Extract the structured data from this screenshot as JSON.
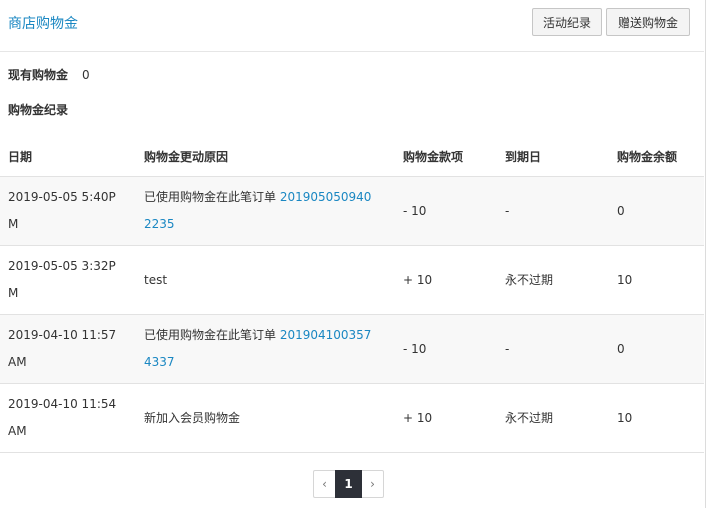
{
  "header": {
    "title": "商店购物金",
    "activity_button": "活动纪录",
    "gift_button": "赠送购物金"
  },
  "summary": {
    "label": "现有购物金",
    "value": "0"
  },
  "records_title": "购物金纪录",
  "table": {
    "headers": [
      "日期",
      "购物金更动原因",
      "购物金款项",
      "到期日",
      "购物金余额"
    ],
    "rows": [
      {
        "date_l1": "2019-05-05 5:40P",
        "date_l2": "M",
        "reason": "已使用购物金在此笔订单 ",
        "order_l1": "201905050940",
        "order_l2": "2235",
        "amount": "- 10",
        "expiry": "-",
        "balance": "0"
      },
      {
        "date_l1": "2019-05-05 3:32P",
        "date_l2": "M",
        "reason": "test",
        "order_l1": "",
        "order_l2": "",
        "amount": "+ 10",
        "expiry": "永不过期",
        "balance": "10"
      },
      {
        "date_l1": "2019-04-10 11:57",
        "date_l2": "AM",
        "reason": "已使用购物金在此笔订单 ",
        "order_l1": "201904100357",
        "order_l2": "4337",
        "amount": "- 10",
        "expiry": "-",
        "balance": "0"
      },
      {
        "date_l1": "2019-04-10 11:54",
        "date_l2": "AM",
        "reason": "新加入会员购物金",
        "order_l1": "",
        "order_l2": "",
        "amount": "+ 10",
        "expiry": "永不过期",
        "balance": "10"
      }
    ]
  },
  "pagination": {
    "prev": "‹",
    "current": "1",
    "next": "›"
  }
}
